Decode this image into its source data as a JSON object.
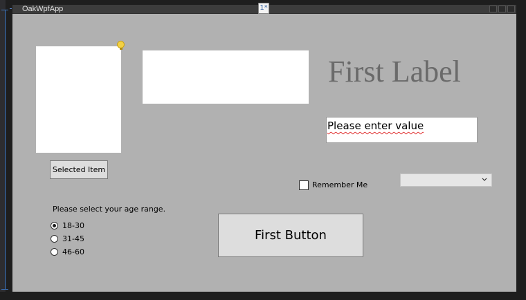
{
  "window": {
    "title": "OakWpfApp",
    "tab_marker": "1*"
  },
  "main": {
    "label": "First Label",
    "textbox_value": "Please enter value",
    "selected_button_label": "Selected Item",
    "checkbox": {
      "label": "Remember Me",
      "checked": false
    },
    "combo": {
      "selected": ""
    },
    "age_prompt": "Please select your age range.",
    "age_options": [
      {
        "label": "18-30",
        "selected": true
      },
      {
        "label": "31-45",
        "selected": false
      },
      {
        "label": "46-60",
        "selected": false
      }
    ],
    "primary_button_label": "First Button"
  },
  "colors": {
    "client_bg": "#b1b1b1",
    "label": "#6a6a6a",
    "button_bg": "#dddddd"
  }
}
